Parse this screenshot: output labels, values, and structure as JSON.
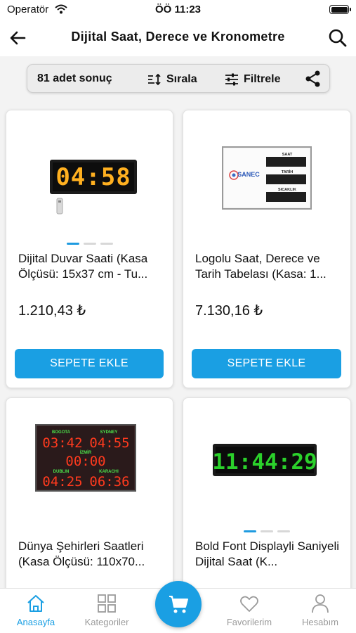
{
  "status_bar": {
    "carrier": "Operatör",
    "time": "ÖÖ 11:23"
  },
  "nav": {
    "title": "Dijital Saat, Derece ve Kronometre"
  },
  "toolbar": {
    "result_count": "81 adet sonuç",
    "sort_label": "Sırala",
    "filter_label": "Filtrele"
  },
  "products": [
    {
      "name": "Dijital Duvar Saati (Kasa Ölçüsü: 15x37 cm - Tu...",
      "price": "1.210,43 ₺",
      "add_label": "SEPETE EKLE",
      "display_text": "04:58"
    },
    {
      "name": "Logolu Saat, Derece ve Tarih Tabelası (Kasa: 1...",
      "price": "7.130,16 ₺",
      "add_label": "SEPETE EKLE",
      "brand": "SANEC",
      "panel_labels": [
        "SAAT",
        "TARİH",
        "SICAKLIK"
      ]
    },
    {
      "name": "Dünya Şehirleri Saatleri (Kasa Ölçüsü: 110x70...",
      "cities": [
        "BOGOTA",
        "SYDNEY",
        "İZMİR",
        "DUBLIN",
        "KARACHI"
      ],
      "times": [
        "03:42",
        "04:55",
        "00:00",
        "04:25",
        "06:36"
      ]
    },
    {
      "name": "Bold Font Displayli Saniyeli Dijital Saat (K...",
      "display_text": "11:44:29"
    }
  ],
  "tabs": [
    {
      "label": "Anasayfa",
      "icon": "home-icon"
    },
    {
      "label": "Kategoriler",
      "icon": "grid-icon"
    },
    {
      "label": "Favorilerim",
      "icon": "heart-icon"
    },
    {
      "label": "Hesabım",
      "icon": "user-icon"
    }
  ],
  "colors": {
    "accent": "#1a9fe3",
    "inactive": "#9a9a9a",
    "led_red": "#ff3a1e",
    "led_amber": "#ffb020",
    "led_green": "#2bd12b"
  }
}
